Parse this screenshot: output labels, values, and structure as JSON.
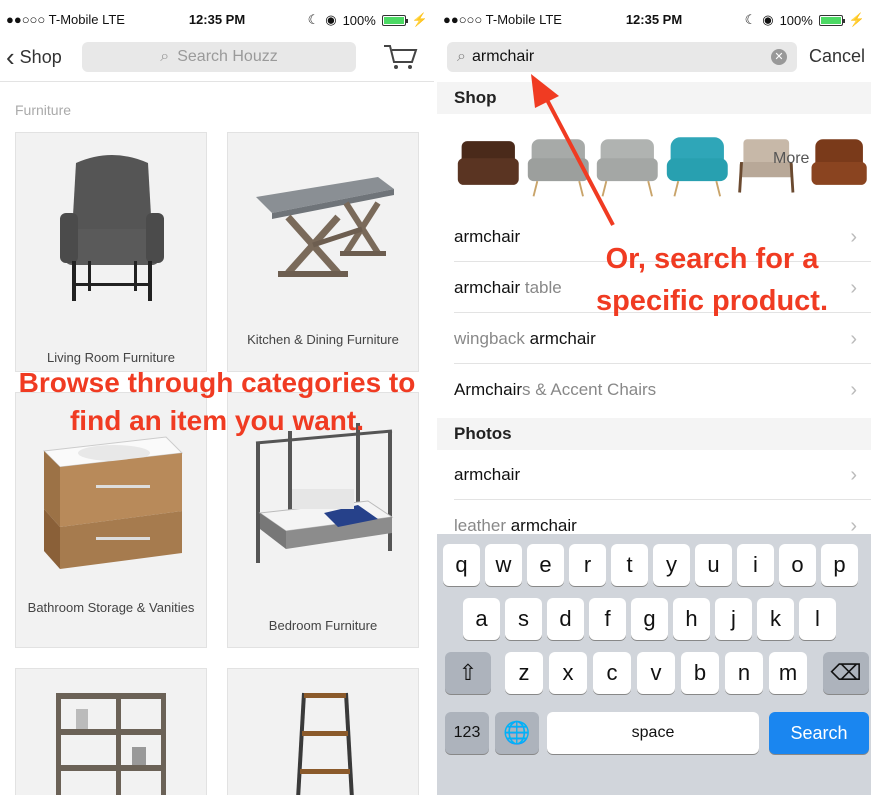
{
  "left": {
    "status": {
      "carrier": "●●○○○ T-Mobile  LTE",
      "time": "12:35 PM",
      "battery": "100%"
    },
    "nav": {
      "back_label": "Shop",
      "search_placeholder": "Search Houzz"
    },
    "section_title": "Furniture",
    "categories": [
      {
        "label": "Living Room Furniture"
      },
      {
        "label": "Kitchen & Dining Furniture"
      },
      {
        "label": "Bathroom Storage & Vanities"
      },
      {
        "label": "Bedroom Furniture"
      }
    ],
    "overlay": "Browse through categories to find an item you want."
  },
  "right": {
    "status": {
      "carrier": "●●○○○ T-Mobile  LTE",
      "time": "12:35 PM",
      "battery": "100%"
    },
    "search": {
      "value": "armchair",
      "cancel_label": "Cancel"
    },
    "shop_header": "Shop",
    "more_label": "More",
    "shop_results": [
      {
        "dim": "",
        "bold": "armchair",
        "rest": ""
      },
      {
        "dim": "",
        "bold": "armchair",
        "rest": " table"
      },
      {
        "dim": "wingback ",
        "bold": "armchair",
        "rest": ""
      },
      {
        "dim": "",
        "bold": "Armchair",
        "rest": "s & Accent Chairs"
      }
    ],
    "photos_header": "Photos",
    "photo_results": [
      {
        "dim": "",
        "bold": "armchair",
        "rest": ""
      },
      {
        "dim": "leather ",
        "bold": "armchair",
        "rest": ""
      }
    ],
    "overlay": "Or, search for a specific product.",
    "keyboard": {
      "row1": [
        "q",
        "w",
        "e",
        "r",
        "t",
        "y",
        "u",
        "i",
        "o",
        "p"
      ],
      "row2": [
        "a",
        "s",
        "d",
        "f",
        "g",
        "h",
        "j",
        "k",
        "l"
      ],
      "row3": [
        "z",
        "x",
        "c",
        "v",
        "b",
        "n",
        "m"
      ],
      "num_label": "123",
      "space_label": "space",
      "search_label": "Search"
    }
  },
  "colors": {
    "annotation": "#f03b22",
    "search_key": "#1a86f0",
    "battery": "#4cd964"
  }
}
